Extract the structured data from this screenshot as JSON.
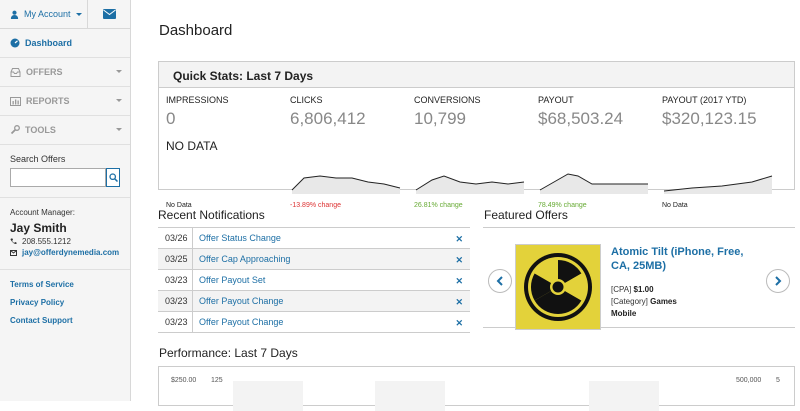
{
  "sidebar": {
    "account_label": "My Account",
    "nav": [
      {
        "label": "Dashboard",
        "icon": "dashboard-icon"
      },
      {
        "label": "OFFERS",
        "icon": "inbox-icon"
      },
      {
        "label": "REPORTS",
        "icon": "bar-chart-icon"
      },
      {
        "label": "TOOLS",
        "icon": "wrench-icon"
      }
    ],
    "search": {
      "label": "Search Offers",
      "value": ""
    },
    "manager": {
      "label": "Account Manager:",
      "name": "Jay Smith",
      "phone": "208.555.1212",
      "email": "jay@offerdynemedia.com"
    },
    "links": [
      "Terms of Service",
      "Privacy Policy",
      "Contact Support"
    ]
  },
  "main": {
    "title": "Dashboard",
    "quick_stats": {
      "title": "Quick Stats: Last 7 Days",
      "stats": [
        {
          "label": "IMPRESSIONS",
          "value": "0",
          "nodata": "NO DATA",
          "change": "No Data",
          "change_color": "#222222"
        },
        {
          "label": "CLICKS",
          "value": "6,806,412",
          "change": "-13.89% change",
          "change_color": "#dd3333"
        },
        {
          "label": "CONVERSIONS",
          "value": "10,799",
          "change": "26.81% change",
          "change_color": "#66aa33"
        },
        {
          "label": "PAYOUT",
          "value": "$68,503.24",
          "change": "78.49% change",
          "change_color": "#66aa33"
        },
        {
          "label": "PAYOUT (2017 YTD)",
          "value": "$320,123.15",
          "change": "No Data",
          "change_color": "#222222"
        }
      ]
    },
    "notifications": {
      "title": "Recent Notifications",
      "rows": [
        {
          "date": "03/26",
          "text": "Offer Status Change"
        },
        {
          "date": "03/25",
          "text": "Offer Cap Approaching"
        },
        {
          "date": "03/23",
          "text": "Offer Payout Set"
        },
        {
          "date": "03/23",
          "text": "Offer Payout Change"
        },
        {
          "date": "03/23",
          "text": "Offer Payout Change"
        }
      ]
    },
    "featured": {
      "title": "Featured Offers",
      "offer_title": "Atomic Tilt (iPhone, Free, CA, 25MB)",
      "type_label": "[CPA]",
      "type_value": "$1.00",
      "category_label": "[Category]",
      "category_value": "Games",
      "platform": "Mobile"
    },
    "performance": {
      "title": "Performance: Last 7 Days",
      "left_axis_top": "$250.00",
      "left_axis_top2": "125",
      "right_axis_top": "500,000",
      "right_axis_top2": "5"
    }
  },
  "colors": {
    "link": "#1d6fa5",
    "negative": "#dd3333",
    "positive": "#66aa33"
  }
}
